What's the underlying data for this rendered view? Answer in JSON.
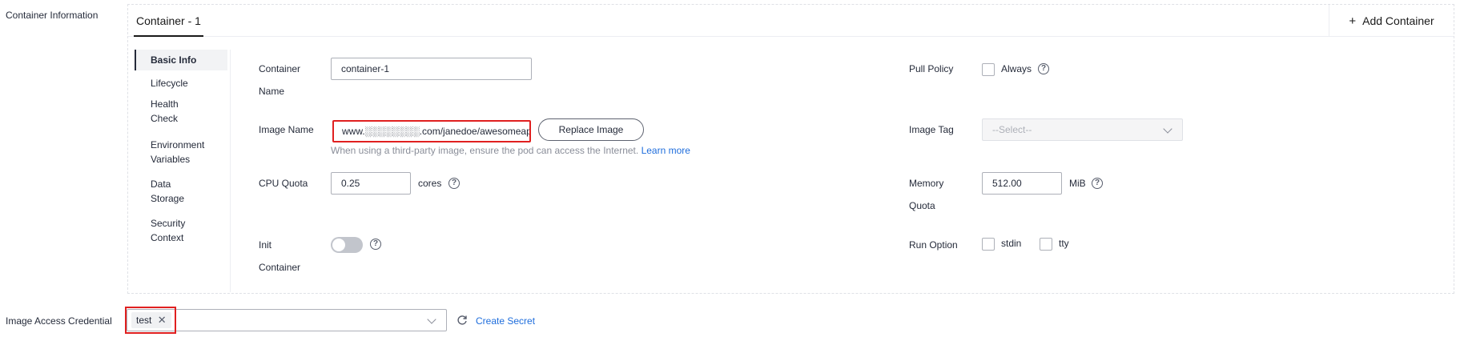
{
  "section_label": "Container Information",
  "tabs": [
    {
      "label": "Container - 1",
      "active": true
    }
  ],
  "add_container": {
    "icon": "plus-icon",
    "label": "Add Container"
  },
  "sidenav": [
    "Basic Info",
    "Lifecycle",
    "Health Check",
    "Environment Variables",
    "Data Storage",
    "Security Context"
  ],
  "sidenav_active": "Basic Info",
  "fields": {
    "container_name": {
      "label": "Container Name",
      "value": "container-1"
    },
    "image_name": {
      "label": "Image Name",
      "value": "www.░░░░░░░░.com/janedoe/awesomeap",
      "replace_button": "Replace Image",
      "hint": "When using a third-party image, ensure the pod can access the Internet.",
      "learn_more": "Learn more"
    },
    "cpu_quota": {
      "label": "CPU Quota",
      "value": "0.25",
      "unit": "cores"
    },
    "init_container": {
      "label": "Init Container",
      "enabled": false
    },
    "pull_policy": {
      "label": "Pull Policy",
      "option": "Always",
      "checked": false
    },
    "image_tag": {
      "label": "Image Tag",
      "placeholder": "--Select--"
    },
    "memory_quota": {
      "label": "Memory Quota",
      "value": "512.00",
      "unit": "MiB"
    },
    "run_option": {
      "label": "Run Option",
      "options": [
        "stdin",
        "tty"
      ]
    }
  },
  "image_access_credential": {
    "label": "Image Access Credential",
    "tags": [
      "test"
    ],
    "create_secret": "Create Secret"
  },
  "colors": {
    "accent_link": "#1e6ddc",
    "highlight_border": "#e02020"
  }
}
